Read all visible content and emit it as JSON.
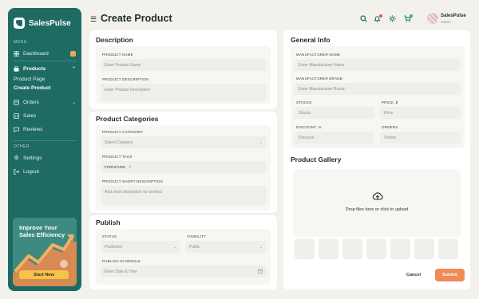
{
  "app": {
    "brand": "SalesPulse"
  },
  "sidebar": {
    "menu_label": "MENU",
    "items": [
      {
        "label": "Dashboard",
        "icon": "grid-icon",
        "badge": ""
      },
      {
        "label": "Products",
        "icon": "bag-icon",
        "active": true
      },
      {
        "label": "Orders",
        "icon": "box-icon"
      },
      {
        "label": "Sales",
        "icon": "chart-icon"
      },
      {
        "label": "Reviews",
        "icon": "message-icon"
      }
    ],
    "sub_items": [
      {
        "label": "Product Page"
      },
      {
        "label": "Create Product",
        "active": true
      }
    ],
    "other_label": "OTHER",
    "other_items": [
      {
        "label": "Settings",
        "icon": "gear-icon"
      },
      {
        "label": "Logout",
        "icon": "logout-icon"
      }
    ],
    "promo": {
      "title": "Improve Your Sales Efficiency",
      "button": "Start Now"
    }
  },
  "header": {
    "title": "Create Product",
    "user": {
      "name": "SalesPulse",
      "role": "Admin"
    }
  },
  "description": {
    "title": "Description",
    "product_name_label": "PRODUCT NAME",
    "product_name_placeholder": "Enter Product Name",
    "product_desc_label": "PRODUCT DESCRIPTION",
    "product_desc_placeholder": "Enter Product Description"
  },
  "categories": {
    "title": "Product Categories",
    "category_label": "PRODUCT CATEGORY",
    "category_value": "Select Category",
    "tags_label": "PRODUCT TAGS",
    "tags": [
      "FORNITURE"
    ],
    "short_desc_label": "PRODUCT SHORT DESCRIPTION",
    "short_desc_placeholder": "Add short description for product"
  },
  "publish": {
    "title": "Publish",
    "status_label": "STATUS",
    "status_value": "Published",
    "visibility_label": "VISIBILITY",
    "visibility_value": "Public",
    "schedule_label": "PUBLISH SCHEDULE",
    "schedule_placeholder": "Enter Date & Time"
  },
  "general": {
    "title": "General Info",
    "manufacturer_name_label": "MANUFACTURER NAME",
    "manufacturer_name_placeholder": "Enter Manufacturer Name",
    "manufacturer_brand_label": "MANUFACTURER BRAND",
    "manufacturer_brand_placeholder": "Enter Manufacturer Brand",
    "stocks_label": "STOCKS",
    "stocks_placeholder": "Stocks",
    "price_label": "PRICE, $",
    "price_placeholder": "Price",
    "discount_label": "DISCOUNT, %",
    "discount_placeholder": "Discount",
    "orders_label": "ORDERS",
    "orders_placeholder": "Orders"
  },
  "gallery": {
    "title": "Product Gallery",
    "drop_text": "Drop files here or click to upload",
    "cancel": "Cancel",
    "submit": "Submit"
  },
  "colors": {
    "primary": "#1d6b63",
    "accent": "#f08a57",
    "promo_button": "#f6c34a",
    "notification": "#e05a4e"
  }
}
